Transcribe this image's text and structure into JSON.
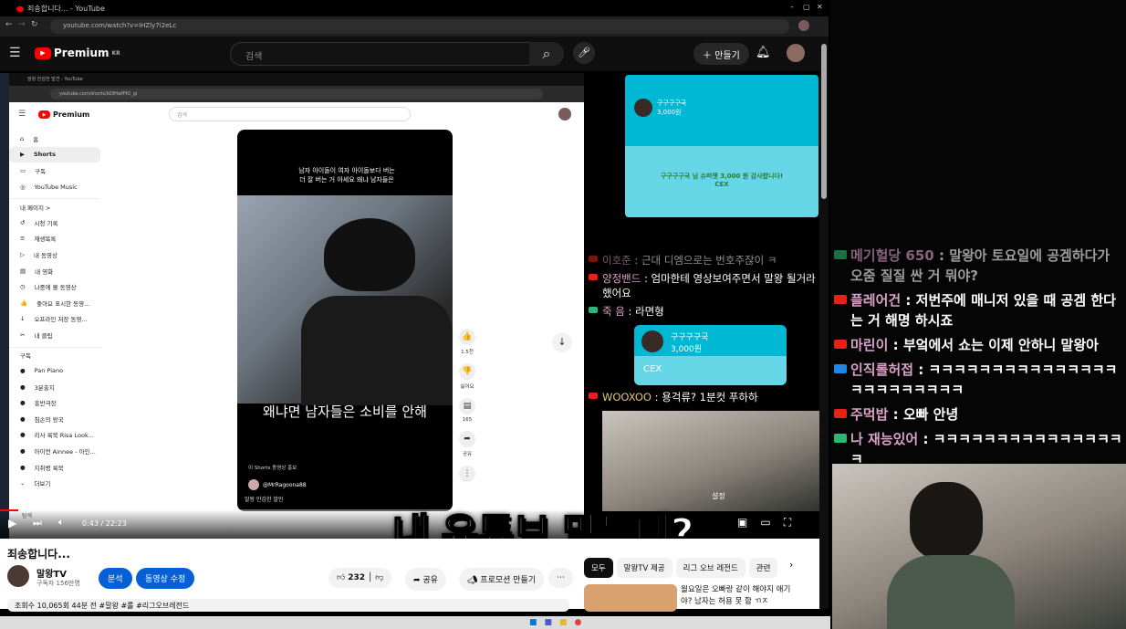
{
  "browser": {
    "tab_title": "죄송합니다... - YouTube",
    "url": "youtube.com/watch?v=IHZly7i2eLc",
    "window_controls": [
      "–",
      "▢",
      "✕"
    ]
  },
  "header": {
    "logo": "Premium",
    "region": "KR",
    "search_placeholder": "검색",
    "create_label": "만들기"
  },
  "inner": {
    "tab_title": "말왕 만감한 발견 - YouTube",
    "url": "youtube.com/shorts/bDIHwfPIO_gl",
    "logo": "Premium",
    "search_placeholder": "검색",
    "nav": [
      {
        "label": "홈",
        "icon": "⌂"
      },
      {
        "label": "Shorts",
        "icon": "▶"
      },
      {
        "label": "구독",
        "icon": "▭"
      },
      {
        "label": "YouTube Music",
        "icon": "◎"
      }
    ],
    "my_page": "내 페이지 >",
    "library": [
      {
        "label": "시청 기록",
        "icon": "↺"
      },
      {
        "label": "재생목록",
        "icon": "≡"
      },
      {
        "label": "내 동영상",
        "icon": "▷"
      },
      {
        "label": "내 영화",
        "icon": "▤"
      },
      {
        "label": "나중에 볼 동영상",
        "icon": "◷"
      },
      {
        "label": "좋아요 표시한 동영...",
        "icon": "👍"
      },
      {
        "label": "오프라인 저장 동영...",
        "icon": "↓"
      },
      {
        "label": "내 클립",
        "icon": "✂"
      }
    ],
    "subs_title": "구독",
    "subs": [
      "Pan Piano",
      "3분출지",
      "흥반극장",
      "침손의 왕국",
      "리사 룩북 Risa Look...",
      "아이언 Ainnee - 아인...",
      "지취병 룩북"
    ],
    "more": "더보기",
    "explore": "탐색",
    "short": {
      "top_caption": "남자 아이돌이 여자 아이돌보다 버는\n더 잘 버는 거 아세요 왜냐 남자들은",
      "subtitle": "왜냐면 남자들은 소비를 안해",
      "promo": "이 Shorts 동영상 홍보",
      "handle": "@MrRagoona88",
      "desc": "말왕 만감한 발언"
    },
    "actions": [
      {
        "icon": "👍",
        "label": "1.5천"
      },
      {
        "icon": "👎",
        "label": "싫어요"
      },
      {
        "icon": "▤",
        "label": "165"
      },
      {
        "icon": "➦",
        "label": "공유"
      },
      {
        "icon": "⋮",
        "label": ""
      }
    ]
  },
  "player": {
    "time": "0:43 / 22:23",
    "progress": 0.032,
    "settings": "설정"
  },
  "caption": "내 유튜브 맞는데?",
  "video": {
    "title": "죄송합니다...",
    "channel": "말왕TV",
    "subscribers": "구독자 156만명",
    "analytics": "분석",
    "edit": "동영상 수정",
    "likes": "232",
    "share": "공유",
    "promo": "프로모션 만들기",
    "meta": "조회수 10,065회  44분 전  #말왕 #롤 #리그오브레전드"
  },
  "chips": [
    "모두",
    "말왕TV 제공",
    "리그 오브 레전드",
    "관련"
  ],
  "rec": {
    "title": "월요일은 오빠랑 같이 해야지 애기야? 남자는 허용 못 함 ㄲㅈ"
  },
  "superchat_big": {
    "name": "구구구구국",
    "amount": "3,000원",
    "thanks": "구구구구국 님 슈퍼챗 3,000 원 감사합니다!",
    "msg": "CEX"
  },
  "chat": [
    {
      "name": "이호준",
      "text": "근대 디엠으로는 번호주잖이 ㅋ"
    },
    {
      "name": "양정밴드",
      "text": "엄마한테 영상보여주면서 말왕 될거라했어요"
    },
    {
      "name": "죽 음",
      "text": "라면형"
    },
    {
      "name": "WOOXOO",
      "text": "용걱류? 1분컷 푸하하"
    }
  ],
  "superchat_small": {
    "name": "구구구구국",
    "amount": "3,000원",
    "msg": "CEX"
  },
  "stream_chat": [
    {
      "name": "메기헐당 650",
      "text": "말왕아 토요일에 공겜하다가 오줌 질질 싼 거 뭐야?",
      "badge": "#2bb673"
    },
    {
      "name": "플레어건",
      "text": "저번주에 매니저 있을 때 공겜 한다는 거 해명 하시죠",
      "badge": "#e62117"
    },
    {
      "name": "마린이",
      "text": "부엌에서 쇼는 이제 안하니 말왕아",
      "badge": "#e62117"
    },
    {
      "name": "인직롤허접",
      "text": "ㅋㅋㅋㅋㅋㅋㅋㅋㅋㅋㅋㅋㅋㅋㅋㅋㅋㅋㅋㅋㅋㅋㅋㅋ",
      "badge": "#1e88e5"
    },
    {
      "name": "주먹밥",
      "text": "오빠 안녕",
      "badge": "#e62117"
    },
    {
      "name": "나 재능있어",
      "text": "ㅋㅋㅋㅋㅋㅋㅋㅋㅋㅋㅋㅋㅋㅋㅋㅋ",
      "badge": "#2bb673"
    }
  ]
}
